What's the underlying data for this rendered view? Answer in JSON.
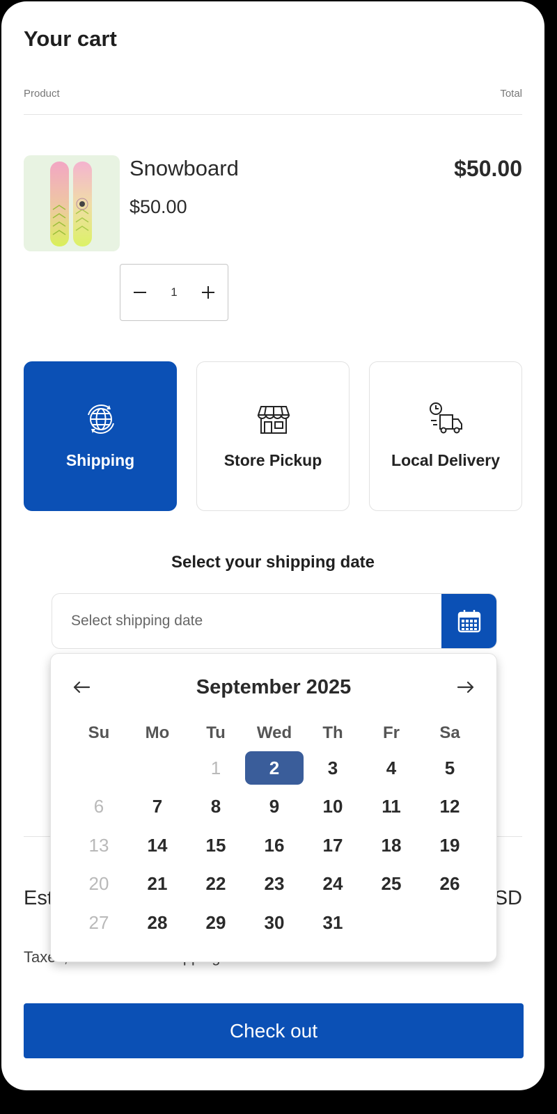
{
  "cart": {
    "title": "Your cart",
    "col_product": "Product",
    "col_total": "Total"
  },
  "item": {
    "name": "Snowboard",
    "price": "$50.00",
    "total": "$50.00",
    "quantity": "1",
    "image_icon": "snowboard-image"
  },
  "methods": [
    {
      "label": "Shipping",
      "icon": "globe-icon",
      "selected": true
    },
    {
      "label": "Store Pickup",
      "icon": "storefront-icon",
      "selected": false
    },
    {
      "label": "Local Delivery",
      "icon": "delivery-truck-icon",
      "selected": false
    }
  ],
  "shipping": {
    "heading": "Select your shipping date",
    "placeholder": "Select shipping date",
    "calendar_icon": "calendar-icon"
  },
  "calendar": {
    "month": "September 2025",
    "weekdays": [
      "Su",
      "Mo",
      "Tu",
      "Wed",
      "Th",
      "Fr",
      "Sa"
    ],
    "first_weekday_index": 2,
    "days_in_month": 31,
    "selected_day": 2,
    "disabled_days": [
      1,
      6,
      13,
      20,
      27
    ]
  },
  "summary": {
    "estimated_label_visible": "Est",
    "currency_visible": "SD",
    "taxes_note": "Taxes, discount and shipping calculated at checkout"
  },
  "checkout_label": "Check out",
  "colors": {
    "accent": "#0b50b5",
    "selected_day": "#3a5d9a",
    "thumbnail_bg": "#e8f3e2"
  }
}
